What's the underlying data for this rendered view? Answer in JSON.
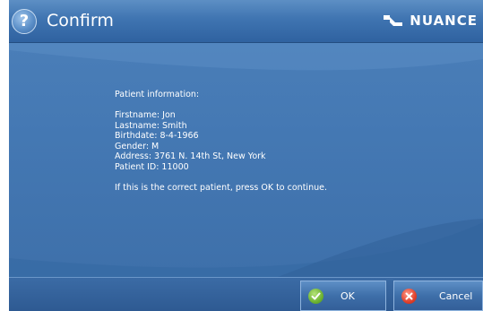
{
  "window": {
    "title": "Confirm",
    "brand": "NUANCE",
    "help_icon_glyph": "?"
  },
  "message": {
    "heading": "Patient information:",
    "fields": [
      "Firstname: Jon",
      "Lastname: Smith",
      "Birthdate: 8-4-1966",
      "Gender: M",
      "Address: 3761 N. 14th St, New York",
      "Patient ID: 11000"
    ],
    "prompt": "If this is the correct patient, press OK to continue."
  },
  "buttons": {
    "ok_label": "OK",
    "cancel_label": "Cancel"
  },
  "icons": {
    "help": "help-icon",
    "brand": "nuance-logo-icon",
    "ok": "check-icon",
    "cancel": "close-icon"
  },
  "colors": {
    "titlebar": "#3f74b1",
    "content": "#4478b3",
    "ok_icon": "#6db332",
    "cancel_icon": "#e0412c"
  }
}
